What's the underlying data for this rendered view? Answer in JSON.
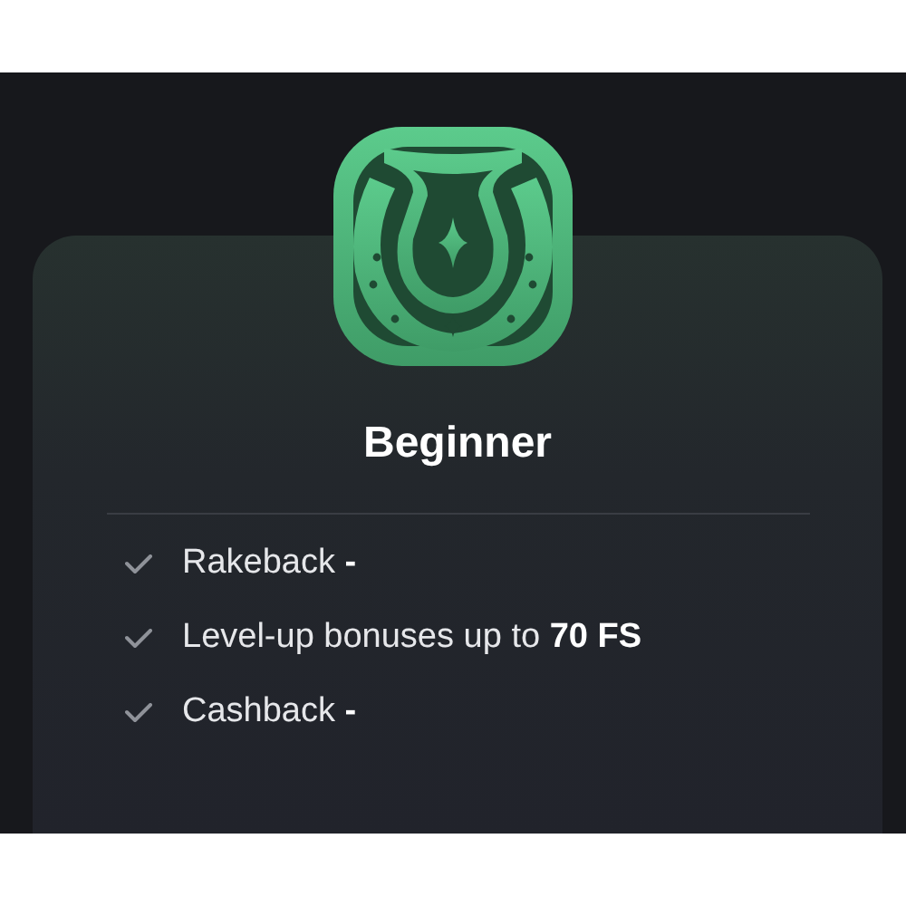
{
  "tier": {
    "title": "Beginner"
  },
  "perks": [
    {
      "text": "Rakeback **-**"
    },
    {
      "text": "Level-up bonuses up to **70 FS**"
    },
    {
      "text": "Cashback **-**"
    }
  ]
}
